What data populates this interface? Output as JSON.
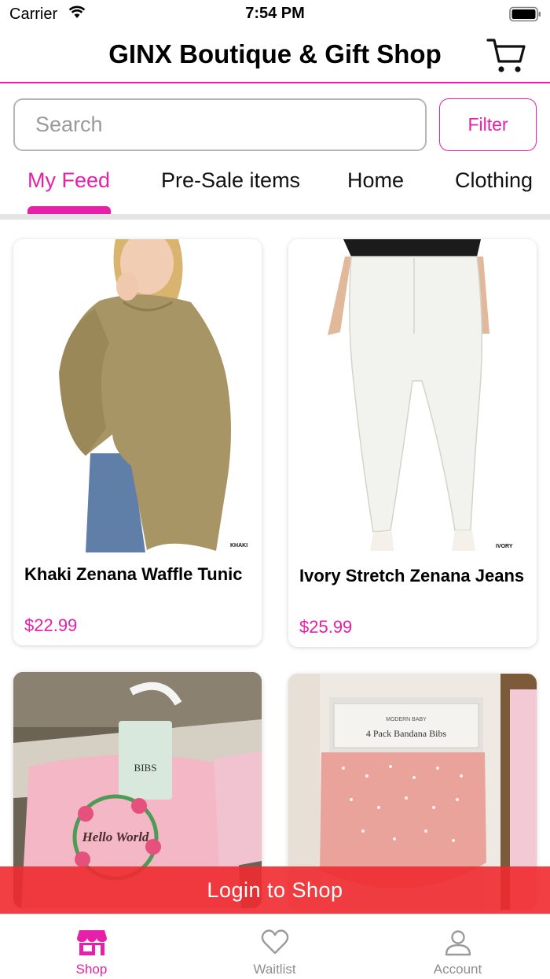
{
  "status_bar": {
    "carrier": "Carrier",
    "time": "7:54 PM"
  },
  "header": {
    "title": "GINX Boutique & Gift Shop"
  },
  "search": {
    "placeholder": "Search",
    "filter_label": "Filter"
  },
  "tabs": [
    {
      "label": "My Feed",
      "active": true
    },
    {
      "label": "Pre-Sale items",
      "active": false
    },
    {
      "label": "Home",
      "active": false
    },
    {
      "label": "Clothing",
      "active": false
    }
  ],
  "products": [
    {
      "name": "Khaki Zenana Waffle Tunic",
      "price": "$22.99",
      "image_tag": "KHAKI"
    },
    {
      "name": "Ivory Stretch Zenana Jeans",
      "price": "$25.99",
      "image_tag": "IVORY"
    },
    {
      "name": "",
      "price": "",
      "image_tag": "BIBS",
      "image_text": "Hello World"
    },
    {
      "name": "",
      "price": "",
      "image_brand": "MODERN BABY",
      "image_text": "4 Pack Bandana Bibs"
    }
  ],
  "login_banner": {
    "label": "Login to Shop"
  },
  "bottom_nav": [
    {
      "label": "Shop",
      "icon": "store-icon",
      "active": true
    },
    {
      "label": "Waitlist",
      "icon": "heart-icon",
      "active": false
    },
    {
      "label": "Account",
      "icon": "person-icon",
      "active": false
    }
  ],
  "colors": {
    "accent": "#e620a8",
    "banner": "#ef2a30"
  }
}
